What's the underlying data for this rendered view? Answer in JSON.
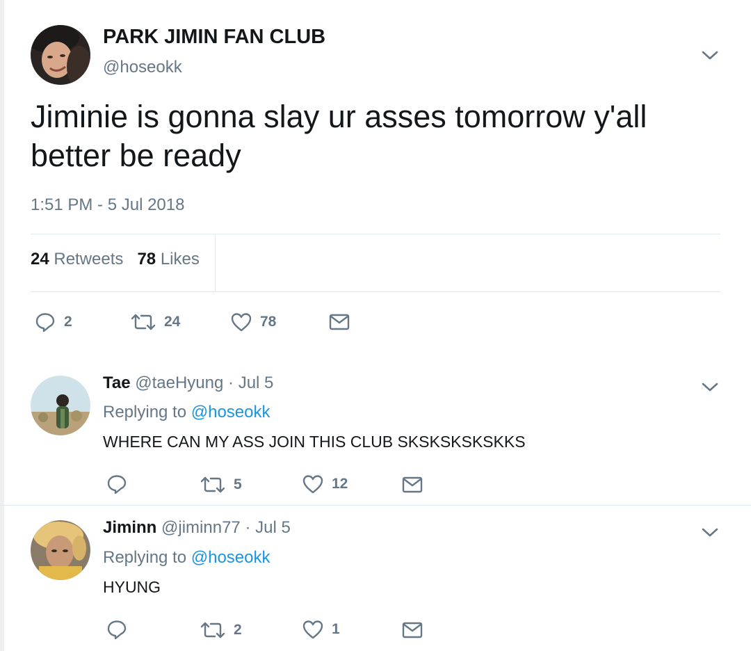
{
  "main_tweet": {
    "author_name": "PARK JIMIN FAN CLUB",
    "handle": "@hoseokk",
    "text": "Jiminie is gonna slay ur asses tomorrow y'all better be ready",
    "timestamp": "1:51 PM - 5 Jul 2018",
    "stats": {
      "retweets_count": "24",
      "retweets_label": "Retweets",
      "likes_count": "78",
      "likes_label": "Likes"
    },
    "actions": {
      "reply_count": "2",
      "retweet_count": "24",
      "like_count": "78"
    }
  },
  "replies": [
    {
      "name": "Tae",
      "handle": "@taeHyung",
      "date": "· Jul 5",
      "replying_label": "Replying to",
      "replying_to": "@hoseokk",
      "text": "WHERE CAN MY ASS JOIN THIS CLUB SKSKSKSKSKKS",
      "reply_count": "",
      "retweet_count": "5",
      "like_count": "12"
    },
    {
      "name": "Jiminn",
      "handle": "@jiminn77",
      "date": "· Jul 5",
      "replying_label": "Replying to",
      "replying_to": "@hoseokk",
      "text": "HYUNG",
      "reply_count": "",
      "retweet_count": "2",
      "like_count": "1"
    }
  ],
  "icons": {
    "reply": "reply-icon",
    "retweet": "retweet-icon",
    "like": "heart-icon",
    "dm": "envelope-icon",
    "more": "chevron-down-icon"
  },
  "colors": {
    "text": "#14171a",
    "secondary": "#657786",
    "link": "#1b95e0",
    "divider": "#e1e8ed"
  }
}
